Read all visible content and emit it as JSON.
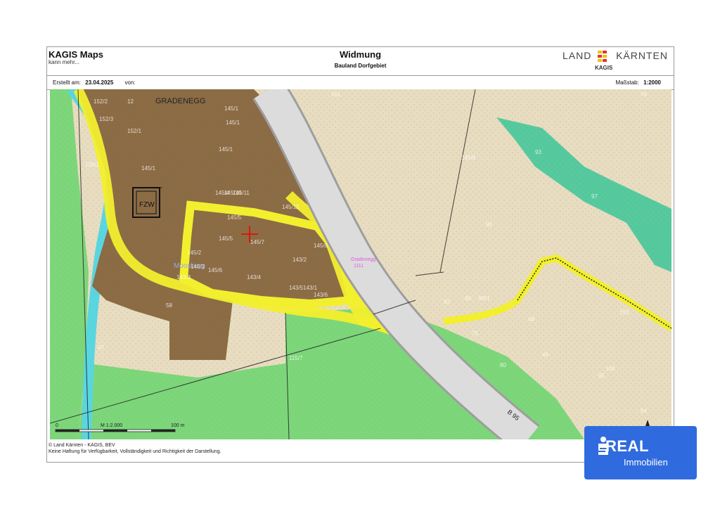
{
  "header": {
    "brand": "KAGIS Maps",
    "brand_sub": "kann mehr...",
    "title": "Widmung",
    "subtitle": "Bauland Dorfgebiet",
    "logo_left": "LAND",
    "logo_right": "KÄRNTEN",
    "logo_sub": "KAGIS"
  },
  "meta": {
    "created_label": "Erstellt am:",
    "created_value": "23.04.2025",
    "by_label": "von:",
    "scale_label": "Maßstab:",
    "scale_value": "1:2000"
  },
  "map": {
    "place_label": "GRADENEGG",
    "fzw_label": "FZW",
    "locality_label": "Moosburg",
    "road_label": "B 95",
    "pink_label_1": "Gradenegg",
    "pink_label_2": "1111",
    "parcels": [
      "152/2",
      "12",
      "145/1",
      "152/3",
      "145/1",
      "145/11",
      "145/12",
      "145/5",
      "145/7",
      "143/2",
      "145/8",
      "145/6",
      "143/3",
      "143/4",
      "143/5",
      "143/6",
      "145/1",
      "126/1",
      "145/1",
      "145/10",
      "145/5",
      "145/4",
      "58",
      "93",
      "97",
      "90",
      "84",
      "95",
      "80",
      "92",
      "88",
      "88/1",
      "48",
      "49",
      "103",
      "104",
      "151",
      "75",
      "47",
      "115/7",
      "145/3",
      "145/2",
      "152/1",
      "145/8",
      "143/1",
      "76"
    ],
    "scalebar": {
      "zero": "0",
      "mid": "M 1:2.000",
      "end": "100 m"
    }
  },
  "footer": {
    "line1": "© Land Kärnten - KAGIS, BEV",
    "line2": "Keine Haftung für Verfügbarkeit, Vollständigkeit und Richtigkeit der Darstellung."
  },
  "badge": {
    "line1": "REAL",
    "line2": "Immobilien",
    "icon": "sparkasse-s-icon"
  },
  "colors": {
    "green": "#7dd67a",
    "brown": "#8c6c45",
    "yellow": "#f2ef2e",
    "cyan": "#5ad6e0",
    "teal": "#47c79a",
    "beige": "#e8ddc0",
    "badge": "#2f6bde"
  }
}
